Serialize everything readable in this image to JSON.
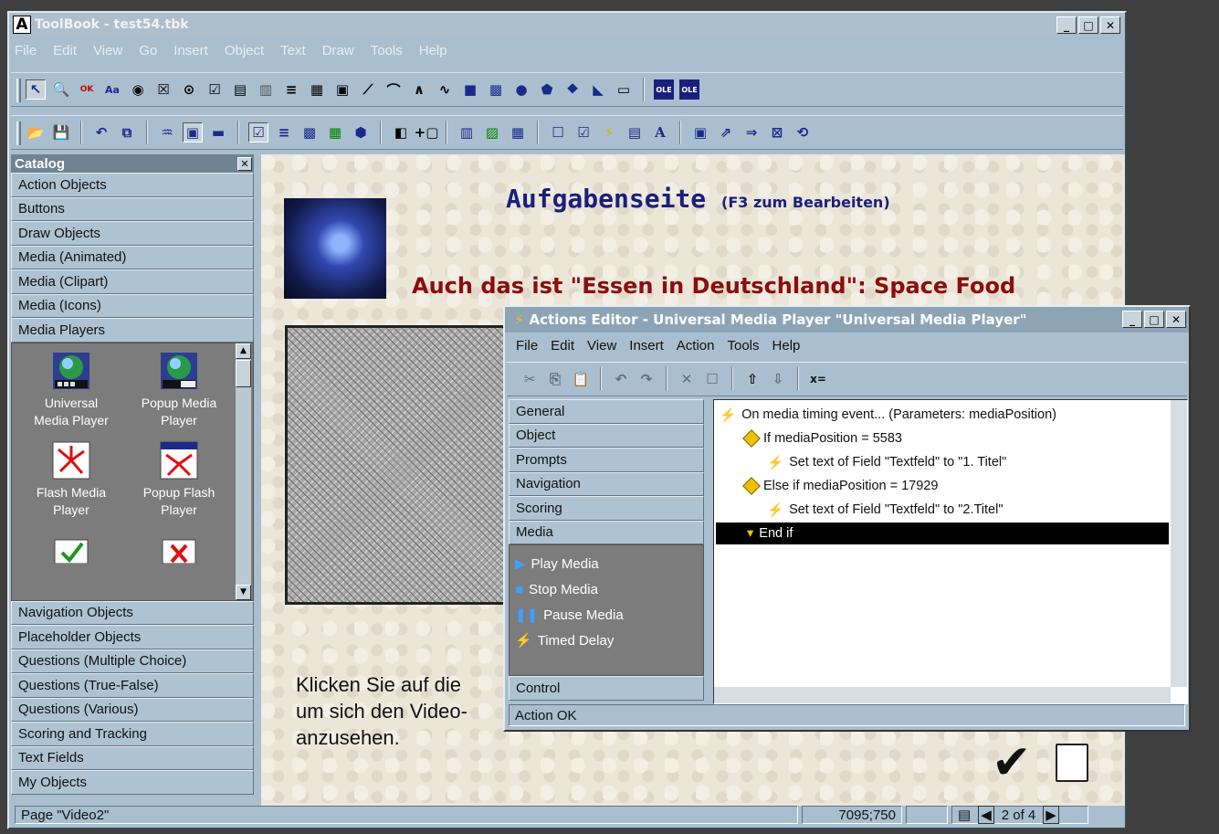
{
  "app": {
    "title": "ToolBook - test54.tbk"
  },
  "menu": [
    "File",
    "Edit",
    "View",
    "Go",
    "Insert",
    "Object",
    "Text",
    "Draw",
    "Tools",
    "Help"
  ],
  "catalog": {
    "title": "Catalog",
    "items_top": [
      "Action Objects",
      "Buttons",
      "Draw Objects",
      "Media (Animated)",
      "Media (Clipart)",
      "Media (Icons)",
      "Media Players"
    ],
    "open_items": [
      {
        "label": "Universal\nMedia Player",
        "icon": "media-player-icon"
      },
      {
        "label": "Popup Media\nPlayer",
        "icon": "popup-media-player-icon"
      },
      {
        "label": "Flash Media\nPlayer",
        "icon": "flash-player-icon"
      },
      {
        "label": "Popup Flash\nPlayer",
        "icon": "popup-flash-player-icon"
      }
    ],
    "items_bottom": [
      "Navigation Objects",
      "Placeholder Objects",
      "Questions (Multiple Choice)",
      "Questions (True-False)",
      "Questions (Various)",
      "Scoring and Tracking",
      "Text Fields",
      "My Objects"
    ]
  },
  "page": {
    "title": "Aufgabenseite",
    "title_hint": "(F3 zum Bearbeiten)",
    "subtitle": "Auch das ist \"Essen in Deutschland\": Space Food",
    "body_line1": "Klicken Sie auf die",
    "body_line2": "um sich den Video-",
    "body_line3": "anzusehen."
  },
  "status": {
    "page": "Page \"Video2\"",
    "coords": "7095;750",
    "page_count": "2 of 4"
  },
  "actions_editor": {
    "title": "Actions Editor - Universal Media Player \"Universal Media Player\"",
    "menu": [
      "File",
      "Edit",
      "View",
      "Insert",
      "Action",
      "Tools",
      "Help"
    ],
    "categories": [
      "General",
      "Object",
      "Prompts",
      "Navigation",
      "Scoring",
      "Media"
    ],
    "media_actions": [
      "Play Media",
      "Stop Media",
      "Pause Media",
      "Timed Delay"
    ],
    "control_label": "Control",
    "script": [
      {
        "text": "On media timing event... (Parameters: mediaPosition)",
        "indent": 0,
        "icon": "bolt"
      },
      {
        "text": "If mediaPosition = 5583",
        "indent": 1,
        "icon": "diamond"
      },
      {
        "text": "Set text of Field \"Textfeld\" to \"1. Titel\"",
        "indent": 2,
        "icon": "bolt"
      },
      {
        "text": "Else if mediaPosition = 17929",
        "indent": 1,
        "icon": "diamond"
      },
      {
        "text": "Set text of Field \"Textfeld\" to \"2.Titel\"",
        "indent": 2,
        "icon": "bolt"
      },
      {
        "text": "End if",
        "indent": 1,
        "icon": "end"
      }
    ],
    "status": "Action OK"
  },
  "colors": {
    "frame": "#a9bfcf",
    "selection": "#000000",
    "title_blue": "#1a1f7c",
    "subtitle_red": "#8a0e0e"
  }
}
